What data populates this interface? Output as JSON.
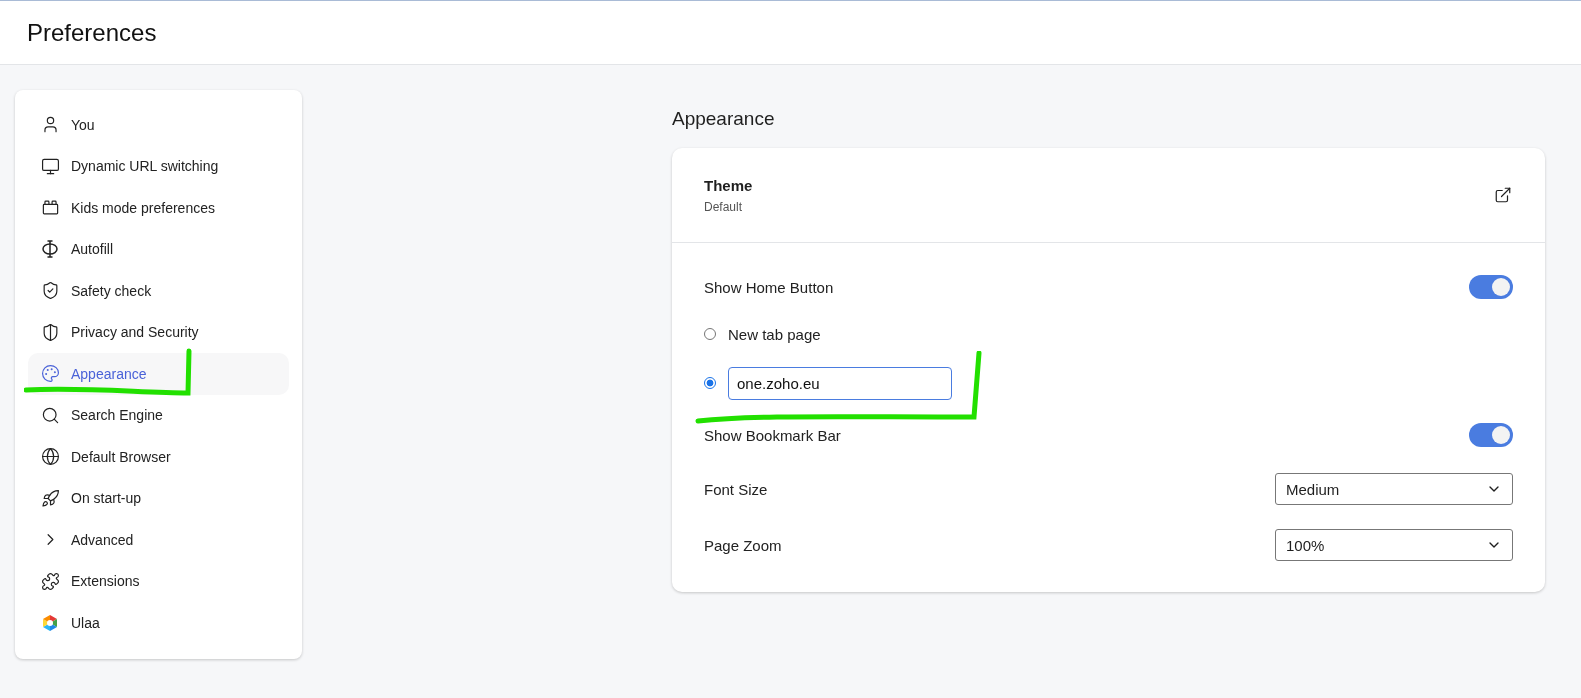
{
  "header": {
    "title": "Preferences"
  },
  "sidebar": {
    "items": [
      {
        "label": "You",
        "selected": false
      },
      {
        "label": "Dynamic URL switching",
        "selected": false
      },
      {
        "label": "Kids mode preferences",
        "selected": false
      },
      {
        "label": "Autofill",
        "selected": false
      },
      {
        "label": "Safety check",
        "selected": false
      },
      {
        "label": "Privacy and Security",
        "selected": false
      },
      {
        "label": "Appearance",
        "selected": true
      },
      {
        "label": "Search Engine",
        "selected": false
      },
      {
        "label": "Default Browser",
        "selected": false
      },
      {
        "label": "On start-up",
        "selected": false
      },
      {
        "label": "Advanced",
        "selected": false
      },
      {
        "label": "Extensions",
        "selected": false
      },
      {
        "label": "Ulaa",
        "selected": false
      }
    ]
  },
  "section": {
    "title": "Appearance",
    "theme": {
      "title": "Theme",
      "value": "Default"
    },
    "home_button": {
      "label": "Show Home Button",
      "on": true,
      "options": [
        {
          "kind": "label",
          "label": "New tab page",
          "selected": false
        },
        {
          "kind": "url",
          "value": "one.zoho.eu",
          "selected": true
        }
      ]
    },
    "bookmark_bar": {
      "label": "Show Bookmark Bar",
      "on": true
    },
    "selects": [
      {
        "label": "Font Size",
        "value": "Medium"
      },
      {
        "label": "Page Zoom",
        "value": "100%"
      }
    ]
  }
}
